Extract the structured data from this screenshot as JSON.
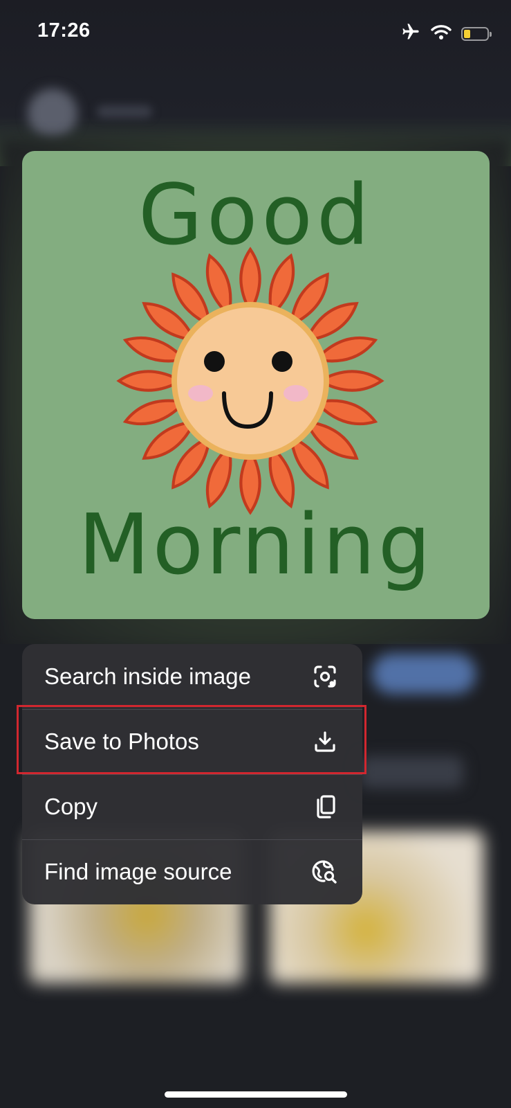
{
  "status_bar": {
    "time": "17:26",
    "battery_level": 0.28
  },
  "image": {
    "line1": "Good",
    "line2": "Morning"
  },
  "context_menu": {
    "items": [
      {
        "label": "Search inside image",
        "icon": "lens-search-icon"
      },
      {
        "label": "Save to Photos",
        "icon": "download-icon",
        "highlighted": true
      },
      {
        "label": "Copy",
        "icon": "copy-icon"
      },
      {
        "label": "Find image source",
        "icon": "globe-search-icon"
      }
    ]
  },
  "colors": {
    "menu_bg": "#303034",
    "highlight": "#d1272f",
    "image_bg": "#83ad80",
    "image_text": "#235f25",
    "petal": "#f06a3a",
    "battery": "#f4cf34"
  }
}
